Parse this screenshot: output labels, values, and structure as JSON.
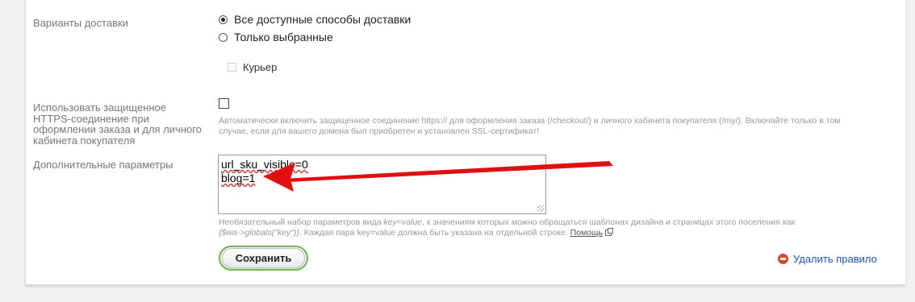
{
  "delivery": {
    "label": "Варианты доставки",
    "options": [
      {
        "label": "Все доступные способы доставки",
        "selected": true
      },
      {
        "label": "Только выбранные",
        "selected": false
      }
    ],
    "courier_label": "Курьер"
  },
  "https": {
    "label_lines": [
      "Использовать защищенное",
      "HTTPS-соединение при",
      "оформлении заказа и для личного",
      "кабинета покупателя"
    ],
    "checked": false,
    "hint_lines": [
      "Автоматически включить защищенное соединение https:// для оформления заказа (/checkout/) и личного кабинета покупателя (/my/). Включайте только в том",
      "случае, если для вашего домена был приобретен и установлен SSL-сертификат!"
    ]
  },
  "params": {
    "label": "Дополнительные параметры",
    "textarea_lines": [
      "url_sku_visible=0",
      "blog=1"
    ],
    "hint_part1": "Необязательный набор параметров вида ",
    "hint_key_value": "key=value",
    "hint_part2": ", к значениям которых можно обращаться шаблонах дизайна и страницах этого поселения как",
    "hint_globals": "{$wa->globals(\"key\")}",
    "hint_part3": ". Каждая пара key=value должна быть указана на отдельной строке. ",
    "help_link": "Помощь"
  },
  "actions": {
    "save_label": "Сохранить",
    "delete_label": "Удалить правило"
  },
  "colors": {
    "save_border": "#68bb48",
    "link": "#1a52b5",
    "arrow": "#e01010",
    "delete_icon": "#d8472b"
  }
}
